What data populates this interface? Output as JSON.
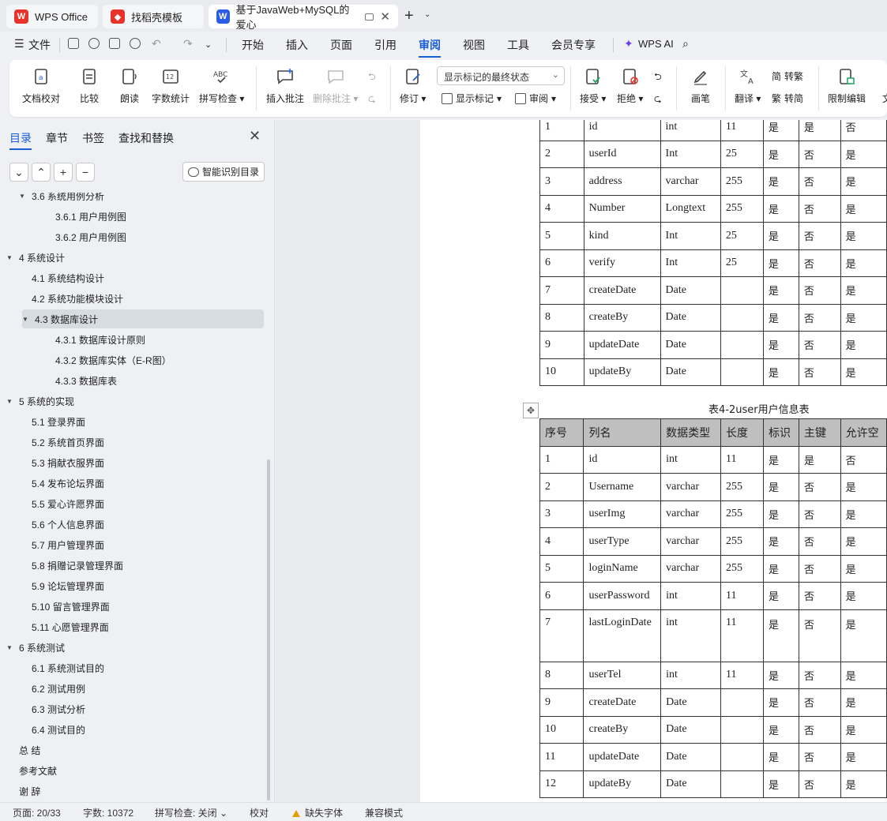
{
  "tabs": [
    {
      "label": "WPS Office",
      "icon": "wps-logo-icon",
      "color": "#e8332a"
    },
    {
      "label": "找稻壳模板",
      "icon": "docer-logo-icon",
      "color": "#e8332a"
    },
    {
      "label": "基于JavaWeb+MySQL的爱心",
      "icon": "word-doc-icon",
      "color": "#2b5ce6"
    }
  ],
  "menu": {
    "file": "文件",
    "items": [
      "开始",
      "插入",
      "页面",
      "引用",
      "审阅",
      "视图",
      "工具",
      "会员专享"
    ],
    "active": "审阅",
    "ai": "WPS AI"
  },
  "ribbon": {
    "doc_check": "文档校对",
    "compare": "比较",
    "read": "朗读",
    "word_count": "字数统计",
    "spell_check": "拼写检查",
    "insert_comment": "插入批注",
    "delete_comment": "删除批注",
    "revise": "修订",
    "markup_dropdown": "显示标记的最终状态",
    "show_markup": "显示标记",
    "review": "审阅",
    "accept": "接受",
    "reject": "拒绝",
    "pen": "画笔",
    "translate": "翻译",
    "to_traditional": "转繁",
    "to_simplified": "转简",
    "restrict_edit": "限制编辑",
    "doc_more": "文"
  },
  "panel": {
    "tabs": [
      "目录",
      "章节",
      "书签",
      "查找和替换"
    ],
    "active_tab": "目录",
    "smart_toc": "智能识别目录",
    "toc": [
      {
        "label": "3.6 系统用例分析",
        "level": 2,
        "expanded": true
      },
      {
        "label": "3.6.1 用户用例图",
        "level": 3
      },
      {
        "label": "3.6.2 用户用例图",
        "level": 3
      },
      {
        "label": "4 系统设计",
        "level": 1,
        "expanded": true
      },
      {
        "label": "4.1 系统结构设计",
        "level": 2
      },
      {
        "label": "4.2 系统功能模块设计",
        "level": 2
      },
      {
        "label": "4.3 数据库设计",
        "level": 2,
        "expanded": true,
        "selected": true
      },
      {
        "label": "4.3.1  数据库设计原则",
        "level": 3
      },
      {
        "label": "4.3.2  数据库实体（E-R图）",
        "level": 3
      },
      {
        "label": "4.3.3  数据库表",
        "level": 3
      },
      {
        "label": "5  系统的实现",
        "level": 1,
        "expanded": true
      },
      {
        "label": "5.1 登录界面",
        "level": 2
      },
      {
        "label": "5.2 系统首页界面",
        "level": 2
      },
      {
        "label": "5.3 捐献衣服界面",
        "level": 2
      },
      {
        "label": "5.4 发布论坛界面",
        "level": 2
      },
      {
        "label": "5.5 爱心许愿界面",
        "level": 2
      },
      {
        "label": "5.6 个人信息界面",
        "level": 2
      },
      {
        "label": "5.7  用户管理界面",
        "level": 2
      },
      {
        "label": "5.8  捐赠记录管理界面",
        "level": 2
      },
      {
        "label": "5.9  论坛管理界面",
        "level": 2
      },
      {
        "label": "5.10  留言管理界面",
        "level": 2
      },
      {
        "label": "5.11  心愿管理界面",
        "level": 2
      },
      {
        "label": "6  系统测试",
        "level": 1,
        "expanded": true
      },
      {
        "label": "6.1 系统测试目的",
        "level": 2
      },
      {
        "label": "6.2  测试用例",
        "level": 2
      },
      {
        "label": "6.3 测试分析",
        "level": 2
      },
      {
        "label": "6.4  测试目的",
        "level": 2
      },
      {
        "label": "总    结",
        "level": 1
      },
      {
        "label": "参考文献",
        "level": 1
      },
      {
        "label": "谢    辞",
        "level": 1
      }
    ]
  },
  "doc": {
    "table1_rows": [
      [
        "1",
        "id",
        "int",
        "11",
        "是",
        "是",
        "否"
      ],
      [
        "2",
        "userId",
        "Int",
        "25",
        "是",
        "否",
        "是"
      ],
      [
        "3",
        "address",
        "varchar",
        "255",
        "是",
        "否",
        "是"
      ],
      [
        "4",
        "Number",
        "Longtext",
        "255",
        "是",
        "否",
        "是"
      ],
      [
        "5",
        "kind",
        "Int",
        "25",
        "是",
        "否",
        "是"
      ],
      [
        "6",
        "verify",
        "Int",
        "25",
        "是",
        "否",
        "是"
      ],
      [
        "7",
        "createDate",
        "Date",
        "",
        "是",
        "否",
        "是"
      ],
      [
        "8",
        "createBy",
        "Date",
        "",
        "是",
        "否",
        "是"
      ],
      [
        "9",
        "updateDate",
        "Date",
        "",
        "是",
        "否",
        "是"
      ],
      [
        "10",
        "updateBy",
        "Date",
        "",
        "是",
        "否",
        "是"
      ]
    ],
    "table2_caption": "表4-2user用户信息表",
    "table2_header": [
      "序号",
      "列名",
      "数据类型",
      "长度",
      "标识",
      "主键",
      "允许空"
    ],
    "table2_rows": [
      [
        "1",
        "id",
        "int",
        "11",
        "是",
        "是",
        "否"
      ],
      [
        "2",
        "Username",
        "varchar",
        "255",
        "是",
        "否",
        "是"
      ],
      [
        "3",
        "userImg",
        "varchar",
        "255",
        "是",
        "否",
        "是"
      ],
      [
        "4",
        "userType",
        "varchar",
        "255",
        "是",
        "否",
        "是"
      ],
      [
        "5",
        "loginName",
        "varchar",
        "255",
        "是",
        "否",
        "是"
      ],
      [
        "6",
        "userPassword",
        "int",
        "11",
        "是",
        "否",
        "是"
      ],
      [
        "7",
        "lastLoginDate",
        "int",
        "11",
        "是",
        "否",
        "是"
      ],
      [
        "8",
        "userTel",
        "int",
        "11",
        "是",
        "否",
        "是"
      ],
      [
        "9",
        "createDate",
        "Date",
        "",
        "是",
        "否",
        "是"
      ],
      [
        "10",
        "createBy",
        "Date",
        "",
        "是",
        "否",
        "是"
      ],
      [
        "11",
        "updateDate",
        "Date",
        "",
        "是",
        "否",
        "是"
      ],
      [
        "12",
        "updateBy",
        "Date",
        "",
        "是",
        "否",
        "是"
      ]
    ]
  },
  "status": {
    "page": "页面: 20/33",
    "words": "字数: 10372",
    "spell": "拼写检查: 关闭",
    "proof": "校对",
    "missing_font": "缺失字体",
    "compat": "兼容模式"
  }
}
